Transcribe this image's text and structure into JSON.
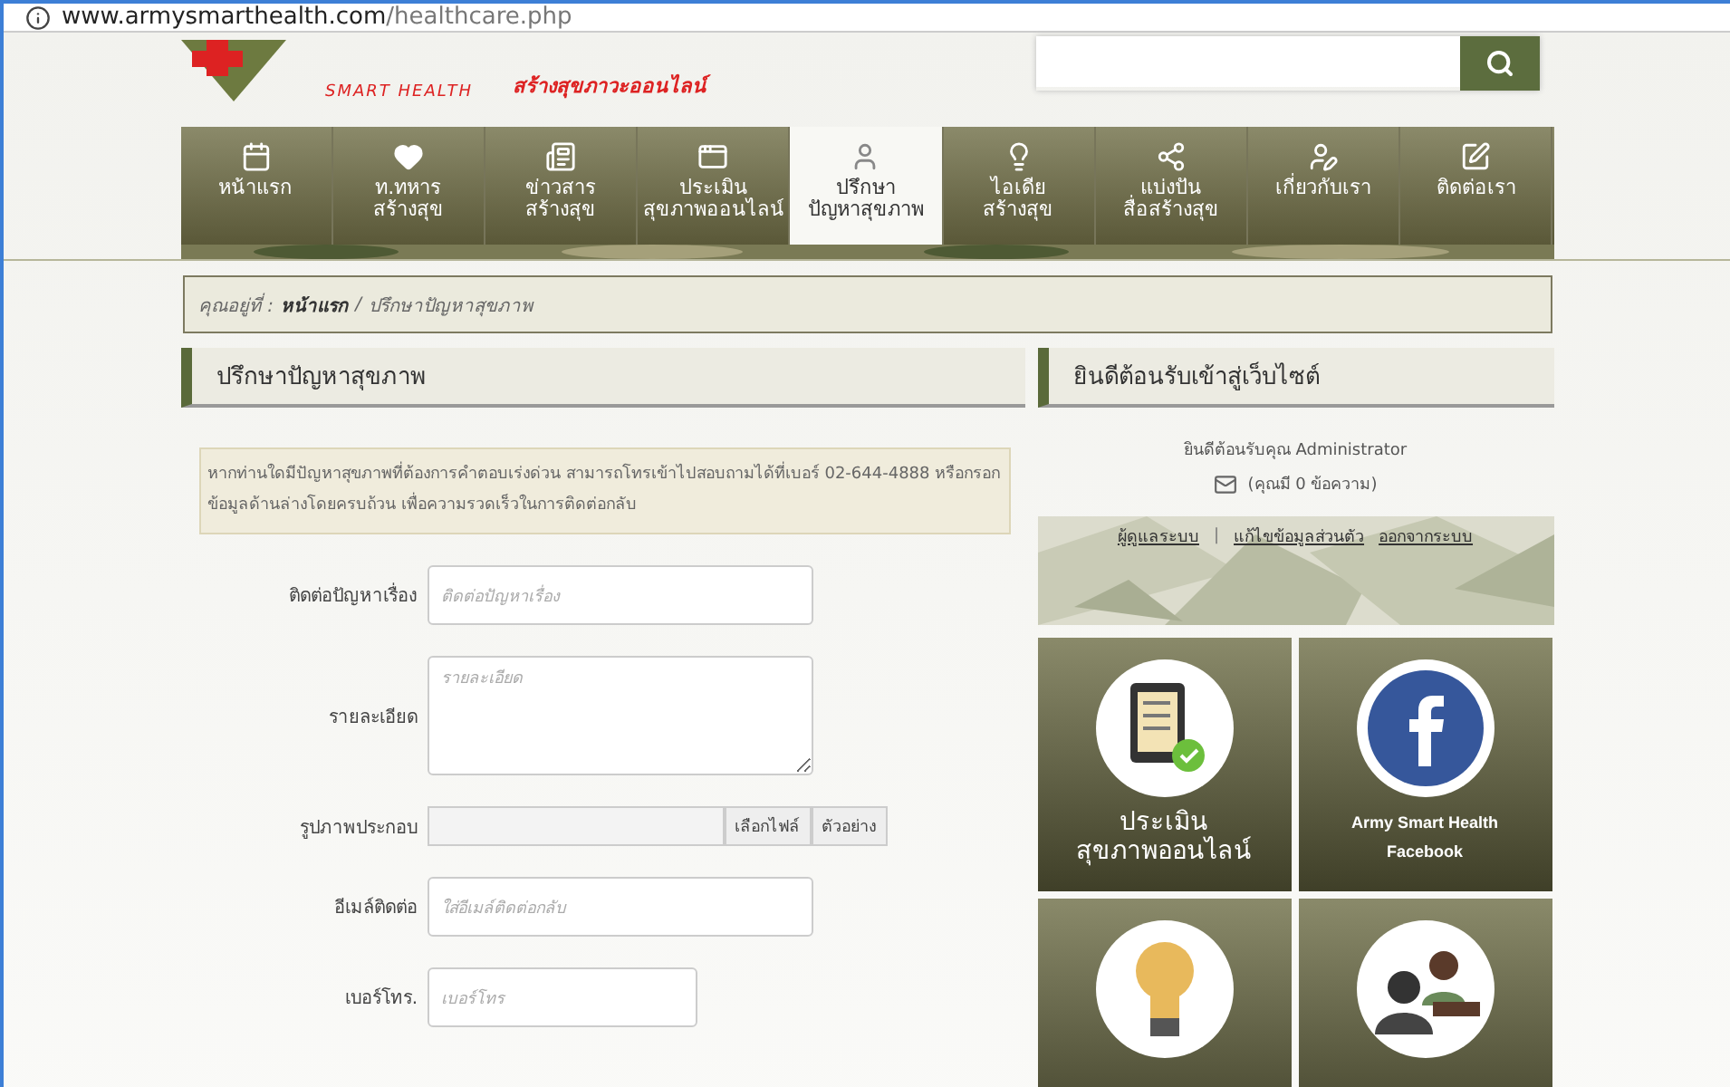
{
  "address_bar": {
    "host": "www.armysmarthealth.com",
    "path": "/healthcare.php"
  },
  "logo": {
    "subtitle": "SMART HEALTH",
    "tagline": "สร้างสุขภาวะออนไลน์"
  },
  "nav": [
    {
      "label": "หน้าแรก",
      "selected": false
    },
    {
      "label": "ท.ทหาร\nสร้างสุข",
      "selected": false
    },
    {
      "label": "ข่าวสาร\nสร้างสุข",
      "selected": false
    },
    {
      "label": "ประเมิน\nสุขภาพออนไลน์",
      "selected": false
    },
    {
      "label": "ปรึกษา\nปัญหาสุขภาพ",
      "selected": true
    },
    {
      "label": "ไอเดีย\nสร้างสุข",
      "selected": false
    },
    {
      "label": "แบ่งปัน\nสื่อสร้างสุข",
      "selected": false
    },
    {
      "label": "เกี่ยวกับเรา",
      "selected": false
    },
    {
      "label": "ติดต่อเรา",
      "selected": false
    }
  ],
  "breadcrumb": {
    "prefix": "คุณอยู่ที่ :",
    "home": "หน้าแรก",
    "separator": "/",
    "current": "ปรึกษาปัญหาสุขภาพ"
  },
  "main": {
    "title": "ปรึกษาปัญหาสุขภาพ",
    "notice": "หากท่านใดมีปัญหาสุขภาพที่ต้องการคำตอบเร่งด่วน สามารถโทรเข้าไปสอบถามได้ที่เบอร์ 02-644-4888 หรือกรอกข้อมูลด้านล่างโดยครบถ้วน เพื่อความรวดเร็วในการติดต่อกลับ",
    "fields": [
      {
        "kind": "text",
        "label": "ติดต่อปัญหาเรื่อง",
        "placeholder": "ติดต่อปัญหาเรื่อง"
      },
      {
        "kind": "textarea",
        "label": "รายละเอียด",
        "placeholder": "รายละเอียด"
      },
      {
        "kind": "file",
        "label": "รูปภาพประกอบ",
        "buttons": [
          "เลือกไฟล์",
          "ตัวอย่าง"
        ]
      },
      {
        "kind": "text",
        "label": "อีเมล์ติดต่อ",
        "placeholder": "ใส่อีเมล์ติดต่อกลับ"
      },
      {
        "kind": "short",
        "label": "เบอร์โทร.",
        "placeholder": "เบอร์โทร"
      }
    ]
  },
  "sidebar": {
    "title": "ยินดีต้อนรับเข้าสู่เว็บไซต์",
    "greeting": "ยินดีต้อนรับคุณ Administrator",
    "messages": "(คุณมี 0 ข้อความ)",
    "links": [
      "ผู้ดูแลระบบ",
      "แก้ไขข้อมูลส่วนตัว",
      "ออกจากระบบ"
    ],
    "link_separator": "|",
    "tiles": [
      {
        "kind": "assessment",
        "label": "ประเมิน\nสุขภาพออนไลน์"
      },
      {
        "kind": "facebook",
        "label": "Army Smart Health\nFacebook"
      },
      {
        "kind": "idea"
      },
      {
        "kind": "consult"
      }
    ]
  }
}
